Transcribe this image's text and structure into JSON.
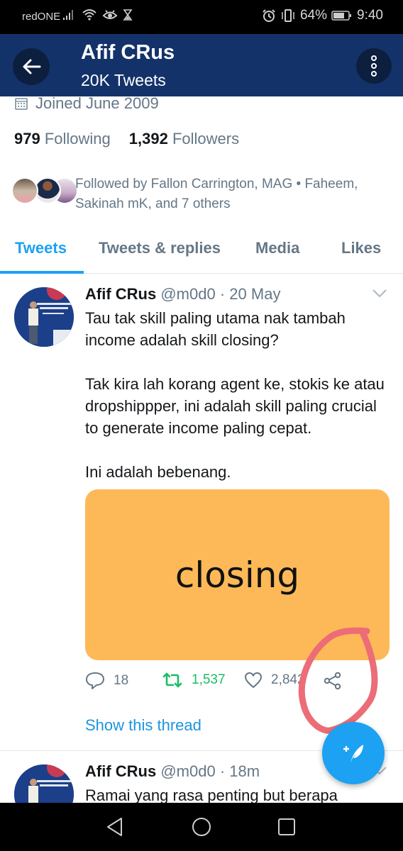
{
  "status_bar": {
    "carrier": "redONE",
    "battery": "64%",
    "time": "9:40",
    "icons": [
      "signal-icon",
      "wifi-icon",
      "eye-icon",
      "hourglass-icon",
      "alarm-icon",
      "vibrate-icon",
      "battery-icon"
    ]
  },
  "header": {
    "title": "Afif CRus",
    "subtitle": "20K Tweets",
    "back_icon": "arrow-left-icon",
    "more_icon": "more-vertical-icon"
  },
  "profile": {
    "joined": "Joined June 2009",
    "following_count": "979",
    "following_label": "Following",
    "followers_count": "1,392",
    "followers_label": "Followers",
    "followed_by": "Followed by Fallon Carrington, MAG • Faheem, Sakinah mK, and 7 others"
  },
  "tabs": [
    {
      "label": "Tweets",
      "active": true
    },
    {
      "label": "Tweets & replies",
      "active": false
    },
    {
      "label": "Media",
      "active": false
    },
    {
      "label": "Likes",
      "active": false
    }
  ],
  "tweets": [
    {
      "name": "Afif CRus",
      "handle": "@m0d0",
      "time": "20 May",
      "text": "Tau tak skill paling utama nak tambah income adalah skill closing?\n\nTak kira lah korang agent ke, stokis ke atau dropshippper, ini adalah skill paling crucial to generate income paling cepat.\n\nIni adalah bebenang.",
      "media_text": "closing",
      "media_color": "#fdb958",
      "replies": "18",
      "retweets": "1,537",
      "likes": "2,842",
      "show_thread": "Show this thread"
    },
    {
      "name": "Afif CRus",
      "handle": "@m0d0",
      "time": "18m",
      "text": "Ramai yang rasa penting but berapa"
    }
  ],
  "colors": {
    "header_bg": "#14326a",
    "accent": "#1da1f2",
    "retweet_green": "#17bf63",
    "annotation_red": "#ec6c77"
  },
  "fab": {
    "icon": "compose-tweet-icon"
  },
  "nav": {
    "icons": [
      "nav-back-icon",
      "nav-home-icon",
      "nav-recents-icon"
    ]
  }
}
